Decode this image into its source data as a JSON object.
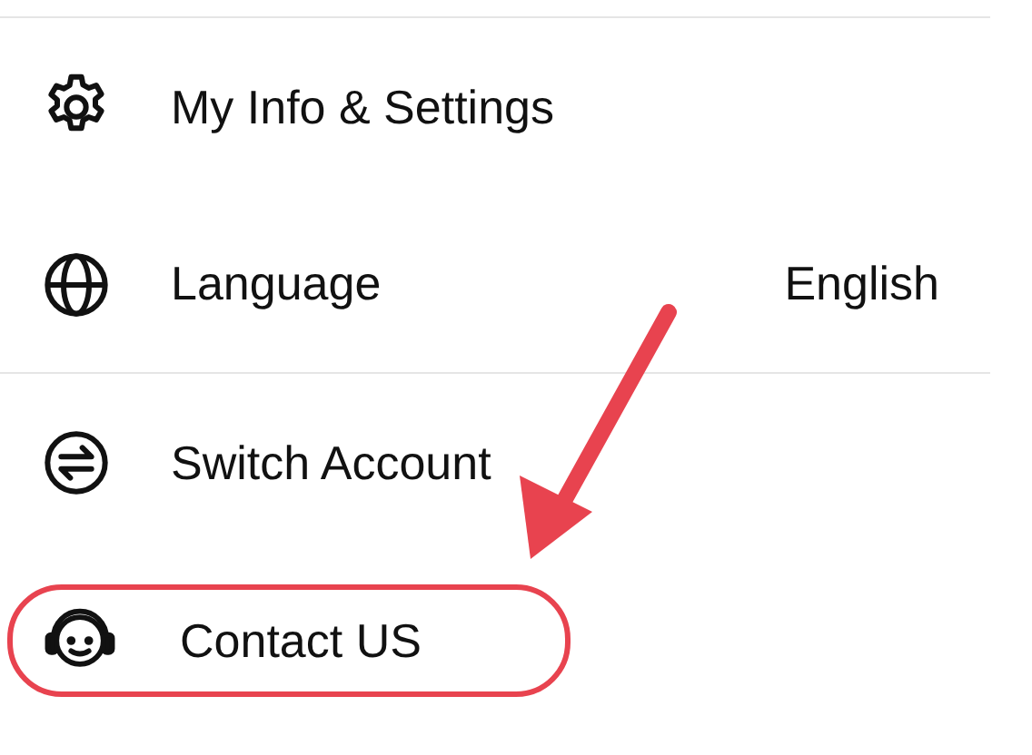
{
  "menu": [
    {
      "kind": "settings",
      "label": "My Info & Settings",
      "divider_after": false,
      "highlighted": false
    },
    {
      "kind": "language",
      "label": "Language",
      "value": "English",
      "divider_after": true,
      "highlighted": false
    },
    {
      "kind": "switch",
      "label": "Switch Account",
      "divider_after": false,
      "highlighted": false
    },
    {
      "kind": "contact",
      "label": "Contact US",
      "divider_after": false,
      "highlighted": true
    }
  ]
}
